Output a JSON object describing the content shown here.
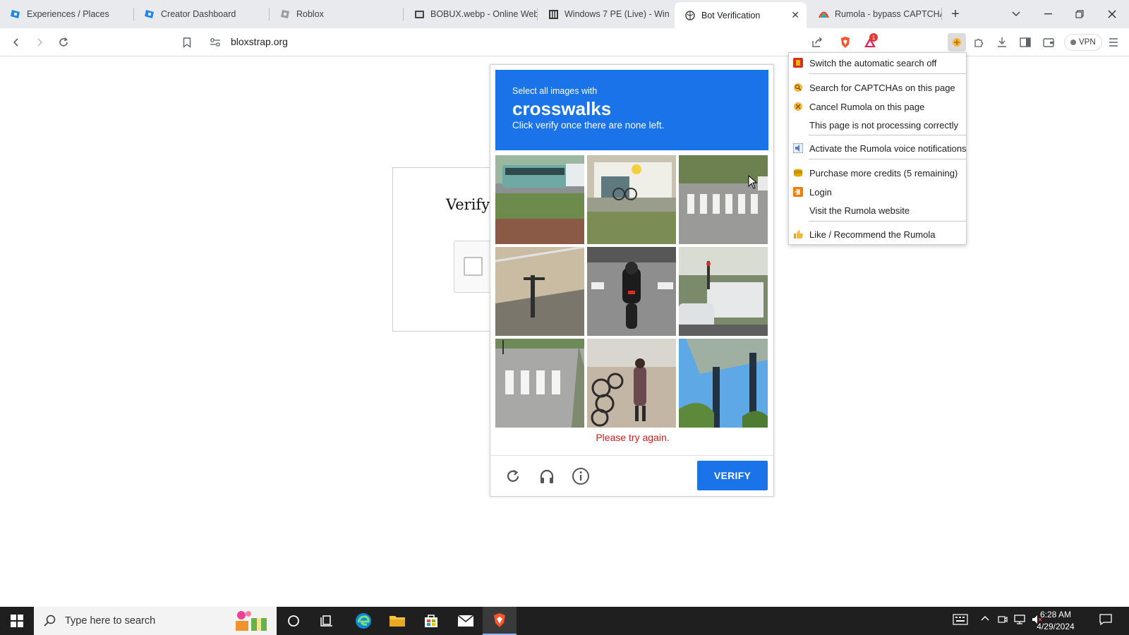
{
  "tabs": [
    {
      "title": "Experiences / Places",
      "icon": "roblox-studio-icon"
    },
    {
      "title": "Creator Dashboard",
      "icon": "roblox-studio-icon"
    },
    {
      "title": "Roblox",
      "icon": "roblox-icon"
    },
    {
      "title": "BOBUX.webp - Online Web",
      "icon": "image-converter-icon"
    },
    {
      "title": "Windows 7 PE (Live) - Win",
      "icon": "windows-page-icon"
    },
    {
      "title": "Bot Verification",
      "icon": "globe-icon",
      "active": true
    },
    {
      "title": "Rumola - bypass CAPTCHA",
      "icon": "rumola-icon"
    }
  ],
  "address_bar": {
    "url": "bloxstrap.org"
  },
  "toolbar": {
    "vpn_label": "VPN",
    "notification_count": "1"
  },
  "verify_card": {
    "title": "Verify"
  },
  "captcha": {
    "instruction": "Select all images with",
    "keyword": "crosswalks",
    "subtext": "Click verify once there are none left.",
    "error": "Please try again.",
    "verify_label": "VERIFY",
    "header_color": "#1a73e8",
    "tiles": [
      "bus on road",
      "storefront with bicycles",
      "crosswalk street",
      "pavement with shadow",
      "motorcycle on road",
      "white van in street",
      "crosswalk road",
      "sidewalk with bicycles",
      "billboard pole"
    ]
  },
  "extension_menu": {
    "items": [
      {
        "label": "Switch the automatic search off",
        "icon": "red-power-icon"
      },
      {
        "label": "Search for CAPTCHAs on this page",
        "icon": "rumola-search-icon"
      },
      {
        "label": "Cancel Rumola on this page",
        "icon": "rumola-cancel-icon"
      },
      {
        "label": "This page is not processing correctly",
        "icon": ""
      },
      {
        "label": "Activate the Rumola voice notifications",
        "icon": "voice-icon"
      },
      {
        "label": "Purchase more credits (5 remaining)",
        "icon": "coins-icon"
      },
      {
        "label": "Login",
        "icon": "login-icon"
      },
      {
        "label": "Visit the Rumola website",
        "icon": ""
      },
      {
        "label": "Like / Recommend the Rumola",
        "icon": "thumbs-up-icon"
      }
    ]
  },
  "taskbar": {
    "search_placeholder": "Type here to search",
    "time": "6:28 AM",
    "date": "4/29/2024"
  }
}
